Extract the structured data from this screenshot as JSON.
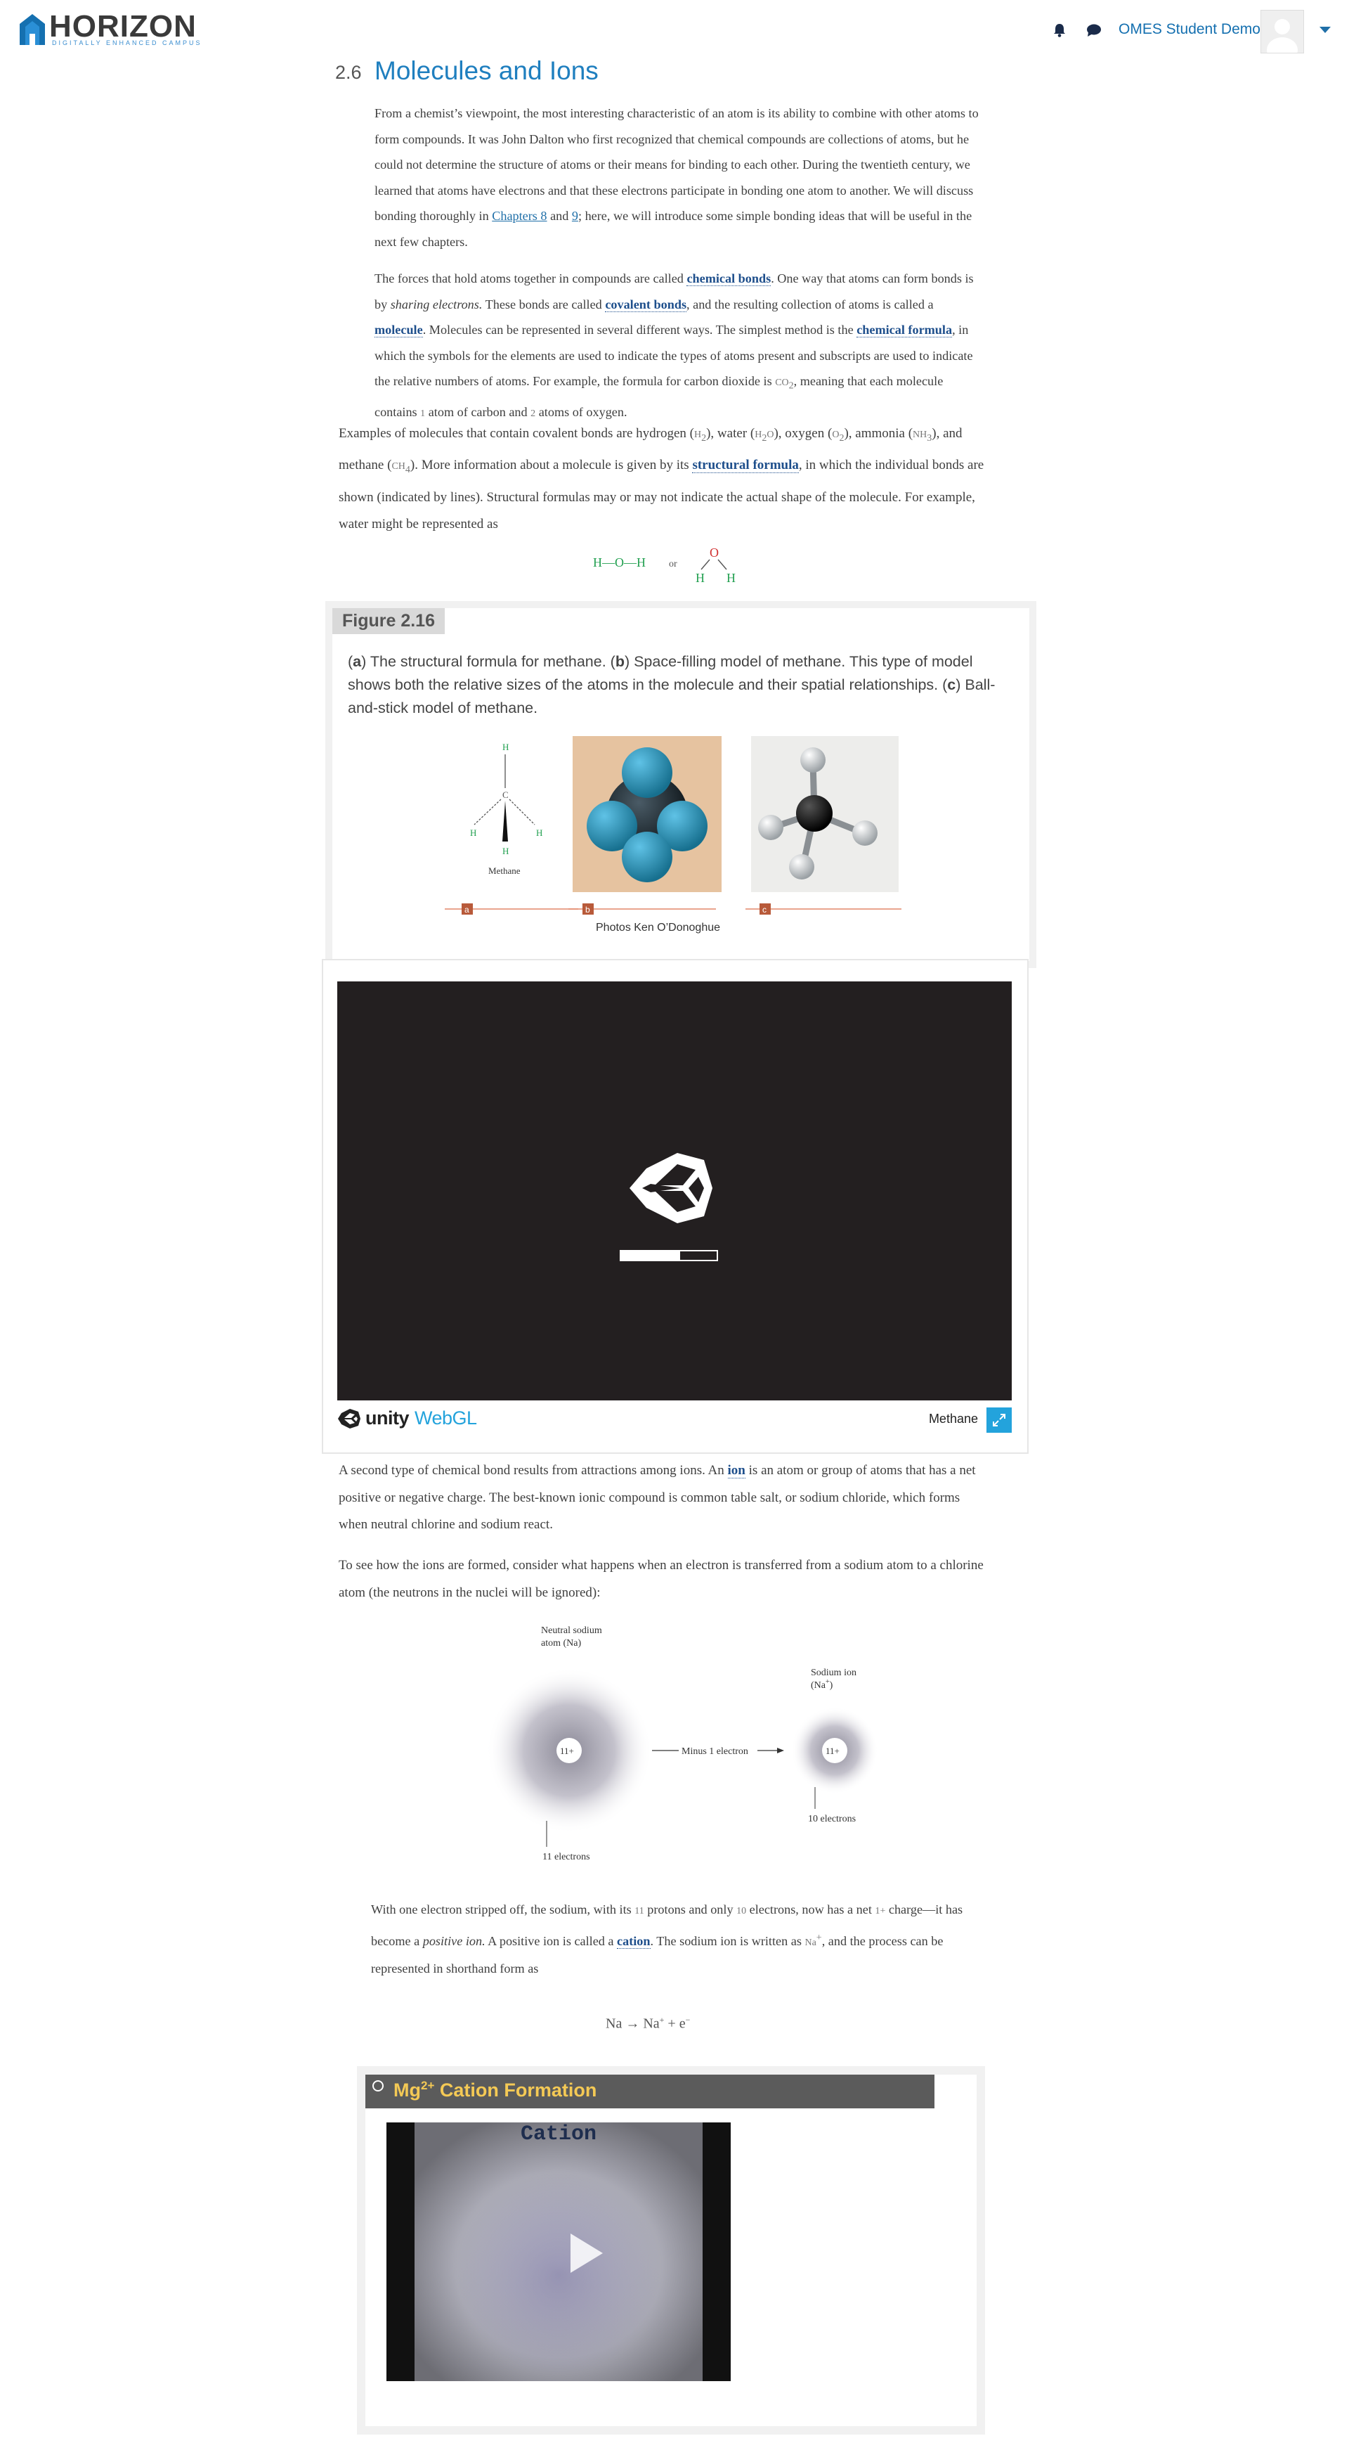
{
  "header": {
    "brand": "HORIZON",
    "tagline": "DIGITALLY ENHANCED CAMPUS",
    "user_name": "OMES Student Demo",
    "brand_color": "#1570b0"
  },
  "section": {
    "number": "2.6",
    "title": "Molecules and Ions"
  },
  "paragraph1": {
    "text_a": "From a chemist’s viewpoint, the most interesting characteristic of an atom is its ability to combine with other atoms to form compounds. It was John Dalton who first recognized that chemical compounds are collections of atoms, but he could not determine the structure of atoms or their means for binding to each other. During the twentieth century, we learned that atoms have electrons and that these electrons participate in bonding one atom to another. We will discuss bonding thoroughly in ",
    "link1": "Chapters 8",
    "and": " and ",
    "link2": "9",
    "text_b": "; here, we will introduce some simple bonding ideas that will be useful in the next few chapters."
  },
  "paragraph2": {
    "t1": "The forces that hold atoms together in compounds are called ",
    "k1": "chemical bonds",
    "t2": ". One way that atoms can form bonds is by ",
    "i1": "sharing electrons.",
    "t3": " These bonds are called ",
    "k2": "covalent bonds",
    "t4": ", and the resulting collection of atoms is called a ",
    "k3": "molecule",
    "t5": ". Molecules can be represented in several different ways. The simplest method is the ",
    "k4": "chemical formula",
    "t6": ", in which the symbols for the elements are used to indicate the types of atoms present and subscripts are used to indicate the relative numbers of atoms. For example, the formula for carbon dioxide is ",
    "f1": "CO",
    "f1sub": "2",
    "t7": ", meaning that each molecule contains ",
    "n1": "1",
    "t8": " atom of carbon and ",
    "n2": "2",
    "t9": " atoms of oxygen."
  },
  "paragraph3": {
    "t1": "Examples of molecules that contain covalent bonds are hydrogen (",
    "h2": "H",
    "h2s": "2",
    "t2": "), water (",
    "w1": "H",
    "w1s": "2",
    "w2": "O",
    "t3": "), oxygen (",
    "o2": "O",
    "o2s": "2",
    "t4": "), ammonia (",
    "nh": "NH",
    "nhs": "3",
    "t5": "), and methane (",
    "ch": "CH",
    "chs": "4",
    "t6": "). More information about a molecule is given by its ",
    "k1": "structural formula",
    "t7": ", in which the individual bonds are shown (indicated by lines). Structural formulas may or may not indicate the actual shape of the molecule. For example, water might be represented as"
  },
  "water_formula": {
    "linear": "H—O—H",
    "or": "or",
    "o": "O",
    "h": "H"
  },
  "figure": {
    "label": "Figure 2.16",
    "caption_a": "a",
    "caption_t1": ") The structural formula for methane. (",
    "caption_b": "b",
    "caption_t2": ") Space-filling model of methane. This type of model shows both the relative sizes of the atoms in the molecule and their spatial relationships. (",
    "caption_c": "c",
    "caption_t3": ") Ball-and-stick model of methane.",
    "panel_a_name": "Methane",
    "atom_h": "H",
    "atom_c": "C",
    "tag_a": "a",
    "tag_b": "b",
    "tag_c": "c",
    "credit": "Photos Ken O’Donoghue"
  },
  "unity_player": {
    "brand": "unity",
    "brand2": "WebGL",
    "game_name": "Methane",
    "loading_fraction": 0.62,
    "accent": "#23a3dc"
  },
  "paragraph4": {
    "t1": "A second type of chemical bond results from attractions among ions. An ",
    "k1": "ion",
    "t2": " is an atom or group of atoms that has a net positive or negative charge. The best-known ionic compound is common table salt, or sodium chloride, which forms when neutral chlorine and sodium react."
  },
  "paragraph5": {
    "text": "To see how the ions are formed, consider what happens when an electron is transferred from a sodium atom to a chlorine atom (the neutrons in the nuclei will be ignored):"
  },
  "sodium_diagram": {
    "left_label_1": "Neutral sodium",
    "left_label_2": "atom (Na)",
    "left_charge": "11+",
    "arrow_label": "Minus 1 electron",
    "right_label_1": "Sodium ion",
    "right_label_2": "(Na",
    "right_label_sup": "+",
    "right_label_end": ")",
    "right_charge": "11+",
    "left_bottom": "11 electrons",
    "right_bottom": "10 electrons"
  },
  "paragraph6": {
    "t1": "With one electron stripped off, the sodium, with its ",
    "n1": "11",
    "t2": " protons and only ",
    "n2": "10",
    "t3": " electrons, now has a net ",
    "n3": "1+",
    "t4": " charge—it has become a ",
    "i1": "positive ion.",
    "t5": " A positive ion is called a ",
    "k1": "cation",
    "t6": ". The sodium ion is written as ",
    "na": "Na",
    "nasup": "+",
    "t7": ", and the process can be represented in shorthand form as"
  },
  "equation": {
    "text": "Na → Na",
    "sup1": "+",
    "mid": " + e",
    "sup2": "−"
  },
  "video": {
    "title_mg": "Mg",
    "title_sup": "2+",
    "title_rest": " Cation Formation",
    "frame_caption": "Cation",
    "title_color": "#f4c955"
  }
}
